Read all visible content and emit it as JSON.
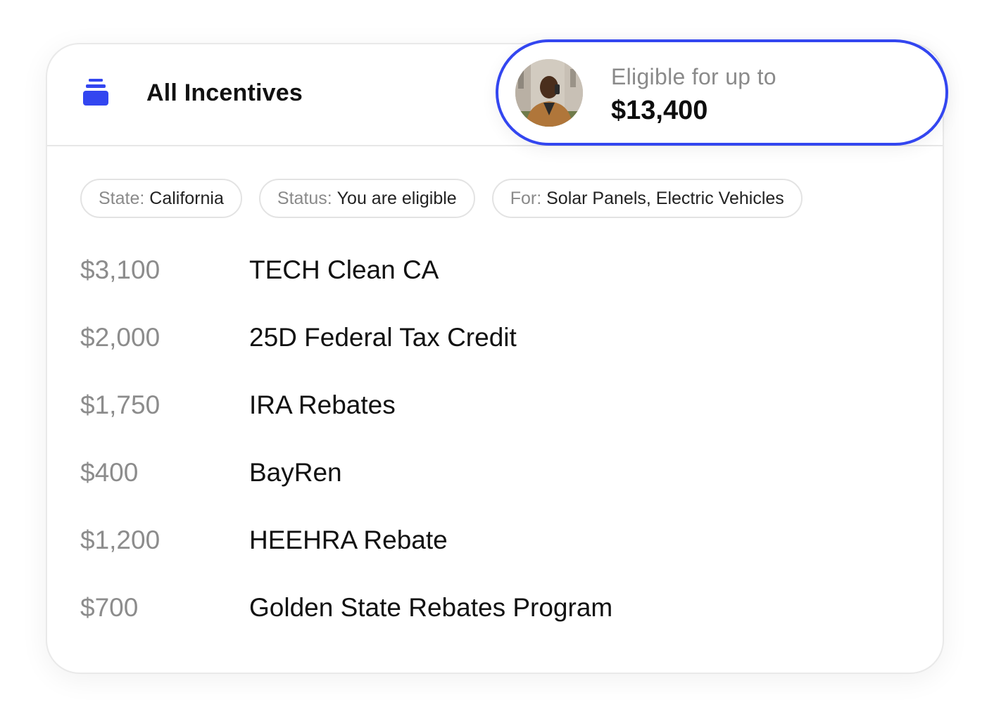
{
  "header": {
    "title": "All Incentives",
    "icon": "stack-icon",
    "accent_color": "#3346f0"
  },
  "eligibility": {
    "label": "Eligible for up to",
    "amount": "$13,400"
  },
  "filters": [
    {
      "key": "State:",
      "value": "California"
    },
    {
      "key": "Status:",
      "value": "You are eligible"
    },
    {
      "key": "For:",
      "value": "Solar Panels, Electric Vehicles"
    }
  ],
  "incentives": [
    {
      "amount": "$3,100",
      "name": "TECH Clean CA"
    },
    {
      "amount": "$2,000",
      "name": "25D Federal Tax Credit"
    },
    {
      "amount": "$1,750",
      "name": "IRA Rebates"
    },
    {
      "amount": "$400",
      "name": "BayRen"
    },
    {
      "amount": "$1,200",
      "name": "HEEHRA Rebate"
    },
    {
      "amount": "$700",
      "name": "Golden State Rebates Program"
    }
  ]
}
